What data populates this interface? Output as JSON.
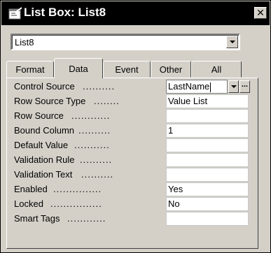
{
  "window": {
    "title": "List Box: List8"
  },
  "selector": {
    "selected": "List8"
  },
  "tabs": [
    {
      "label": "Format"
    },
    {
      "label": "Data"
    },
    {
      "label": "Event"
    },
    {
      "label": "Other"
    },
    {
      "label": "All"
    }
  ],
  "properties": [
    {
      "label": "Control Source",
      "dots": "..........",
      "value": "LastName"
    },
    {
      "label": "Row Source Type",
      "dots": "........",
      "value": "Value List"
    },
    {
      "label": "Row Source",
      "dots": "............",
      "value": ""
    },
    {
      "label": "Bound Column",
      "dots": "..........",
      "value": "1"
    },
    {
      "label": "Default Value",
      "dots": "...........",
      "value": ""
    },
    {
      "label": "Validation Rule",
      "dots": "..........",
      "value": ""
    },
    {
      "label": "Validation Text",
      "dots": "..........",
      "value": ""
    },
    {
      "label": "Enabled",
      "dots": "...............",
      "value": "Yes"
    },
    {
      "label": "Locked",
      "dots": "................",
      "value": "No"
    },
    {
      "label": "Smart Tags",
      "dots": "............",
      "value": ""
    }
  ],
  "builder_button": "..."
}
